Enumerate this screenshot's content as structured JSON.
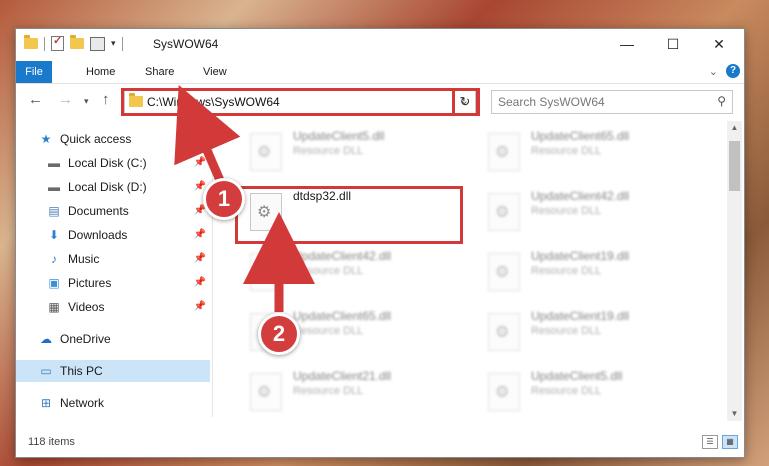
{
  "window": {
    "title": "SysWOW64",
    "controls": {
      "minimize": "—",
      "maximize": "☐",
      "close": "✕"
    }
  },
  "ribbon": {
    "tabs": [
      "File",
      "Home",
      "Share",
      "View"
    ]
  },
  "nav": {
    "address": "C:\\Windows\\SysWOW64",
    "search_placeholder": "Search SysWOW64"
  },
  "sidebar": {
    "items": [
      {
        "label": "Quick access",
        "icon": "star-icon"
      },
      {
        "label": "Local Disk (C:)",
        "icon": "drive-icon"
      },
      {
        "label": "Local Disk (D:)",
        "icon": "drive-icon"
      },
      {
        "label": "Documents",
        "icon": "documents-icon"
      },
      {
        "label": "Downloads",
        "icon": "download-icon"
      },
      {
        "label": "Music",
        "icon": "music-icon"
      },
      {
        "label": "Pictures",
        "icon": "pictures-icon"
      },
      {
        "label": "Videos",
        "icon": "videos-icon"
      },
      {
        "label": "OneDrive",
        "icon": "cloud-icon"
      },
      {
        "label": "This PC",
        "icon": "computer-icon"
      },
      {
        "label": "Network",
        "icon": "network-icon"
      }
    ]
  },
  "files": {
    "left": [
      {
        "name": "UpdateClient5.dll",
        "type": "Resource DLL"
      },
      {
        "name": "dtdsp32.dll",
        "type": ""
      },
      {
        "name": "UpdateClient42.dll",
        "type": "Resource DLL"
      },
      {
        "name": "UpdateClient65.dll",
        "type": "Resource DLL"
      },
      {
        "name": "UpdateClient21.dll",
        "type": "Resource DLL"
      }
    ],
    "right": [
      {
        "name": "UpdateClient65.dll",
        "type": "Resource DLL"
      },
      {
        "name": "UpdateClient42.dll",
        "type": "Resource DLL"
      },
      {
        "name": "UpdateClient19.dll",
        "type": "Resource DLL"
      },
      {
        "name": "UpdateClient19.dll",
        "type": "Resource DLL"
      },
      {
        "name": "UpdateClient5.dll",
        "type": "Resource DLL"
      }
    ]
  },
  "status": {
    "item_count": "118 items"
  },
  "annotations": {
    "step1": "1",
    "step2": "2",
    "color": "#d23a3a"
  }
}
